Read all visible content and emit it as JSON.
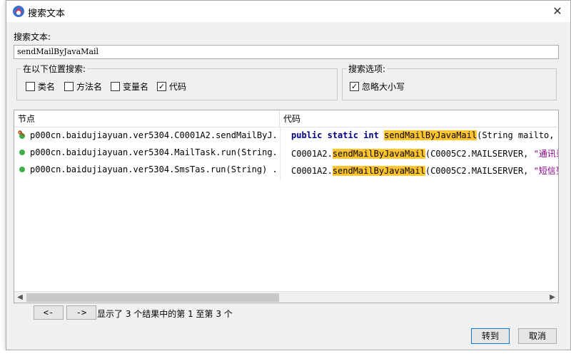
{
  "window": {
    "title": "搜索文本",
    "icon": "app-logo-icon",
    "close": "✕"
  },
  "search": {
    "label": "搜索文本:",
    "value": "sendMailByJavaMail"
  },
  "positions": {
    "title": "在以下位置搜索:",
    "options": [
      {
        "label": "类名",
        "checked": false
      },
      {
        "label": "方法名",
        "checked": false
      },
      {
        "label": "变量名",
        "checked": false
      },
      {
        "label": "代码",
        "checked": true
      }
    ]
  },
  "search_options": {
    "title": "搜索选项:",
    "ignore_case": {
      "label": "忽略大小写",
      "checked": true
    }
  },
  "table": {
    "columns": [
      "节点",
      "代码"
    ],
    "rows": [
      {
        "node": "p000cn.baidujiayuan.ver5304.C0001A2.sendMailByJ...",
        "icon": "method-wrench-icon",
        "code": {
          "kw": "public static int",
          "match": "sendMailByJavaMail",
          "rest": "(String mailto, St"
        }
      },
      {
        "node": "p000cn.baidujiayuan.ver5304.MailTask.run(String...",
        "icon": "green-dot-icon",
        "code": {
          "pre": "C0001A2.",
          "match": "sendMailByJavaMail",
          "mid": "(C0005C2.MAILSERVER, ",
          "str": "\"通讯录"
        }
      },
      {
        "node": "p000cn.baidujiayuan.ver5304.SmsTas.run(String) ...",
        "icon": "green-dot-icon",
        "code": {
          "pre": "C0001A2.",
          "match": "sendMailByJavaMail",
          "mid": "(C0005C2.MAILSERVER, ",
          "str": "\"短信列"
        }
      }
    ]
  },
  "pager": {
    "prev": "<-",
    "next": "->",
    "status": "显示了 3 个结果中的第 1 至第 3 个"
  },
  "buttons": {
    "go": "转到",
    "cancel": "取消"
  },
  "colors": {
    "highlight": "#ffc52b",
    "keyword": "#000080",
    "string": "#8b008b",
    "focus_border": "#0078d7"
  }
}
